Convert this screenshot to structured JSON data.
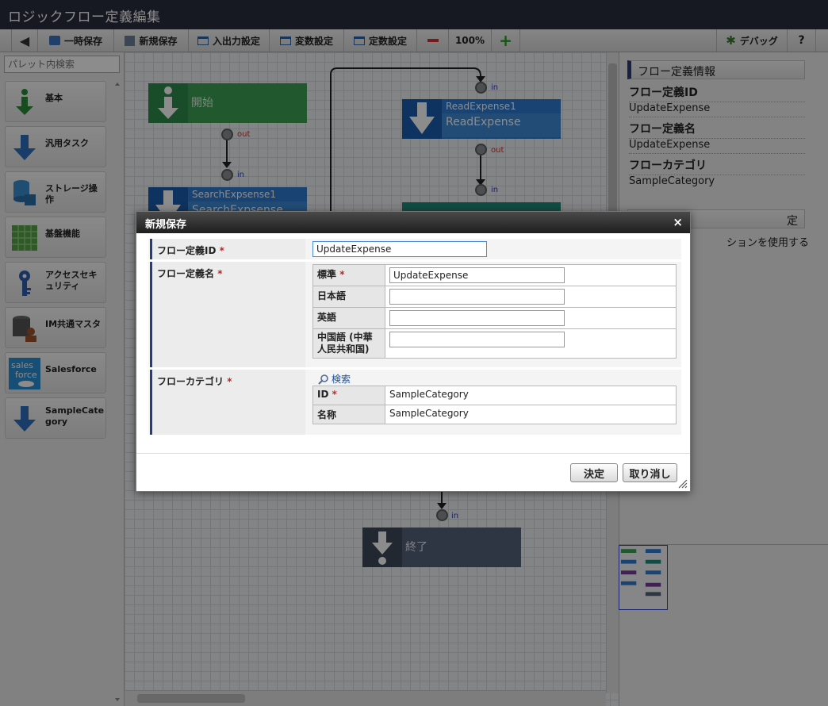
{
  "window": {
    "title": "ロジックフロー定義編集"
  },
  "toolbar": {
    "temp_save": "一時保存",
    "new_save": "新規保存",
    "io_settings": "入出力設定",
    "var_settings": "変数設定",
    "const_settings": "定数設定",
    "zoom": "100%",
    "debug": "デバッグ",
    "help": "?"
  },
  "palette": {
    "search_placeholder": "パレット内検索",
    "items": [
      {
        "label": "基本"
      },
      {
        "label": "汎用タスク"
      },
      {
        "label": "ストレージ操作"
      },
      {
        "label": "基盤機能"
      },
      {
        "label": "アクセスセキュリティ"
      },
      {
        "label": "IM共通マスタ"
      },
      {
        "label": "Salesforce"
      },
      {
        "label": "SampleCategory"
      }
    ]
  },
  "canvas": {
    "nodes": {
      "start": {
        "label": "開始"
      },
      "search": {
        "title": "SearchExpsense1",
        "subtitle": "SearchExpsense"
      },
      "read": {
        "title": "ReadExpense1",
        "subtitle": "ReadExpense"
      },
      "end": {
        "label": "終了"
      }
    },
    "ports": {
      "in": "in",
      "out": "out"
    }
  },
  "right_panel": {
    "section_title": "フロー定義情報",
    "flow_id_label": "フロー定義ID",
    "flow_id_value": "UpdateExpense",
    "flow_name_label": "フロー定義名",
    "flow_name_value": "UpdateExpense",
    "flow_category_label": "フローカテゴリ",
    "flow_category_value": "SampleCategory",
    "section2_title_partial": "定",
    "option_text_partial": "ションを使用する"
  },
  "dialog": {
    "title": "新規保存",
    "close": "×",
    "flow_id": {
      "label": "フロー定義ID",
      "required": "*",
      "value": "UpdateExpense"
    },
    "flow_name": {
      "label": "フロー定義名",
      "required": "*",
      "rows": [
        {
          "label": "標準",
          "required": "*",
          "value": "UpdateExpense"
        },
        {
          "label": "日本語",
          "value": ""
        },
        {
          "label": "英語",
          "value": ""
        },
        {
          "label": "中国語 (中華人民共和国)",
          "value": ""
        }
      ]
    },
    "flow_category": {
      "label": "フローカテゴリ",
      "required": "*",
      "search_label": "検索",
      "id_label": "ID",
      "id_required": "*",
      "id_value": "SampleCategory",
      "name_label": "名称",
      "name_value": "SampleCategory"
    },
    "ok_button": "決定",
    "cancel_button": "取り消し"
  }
}
